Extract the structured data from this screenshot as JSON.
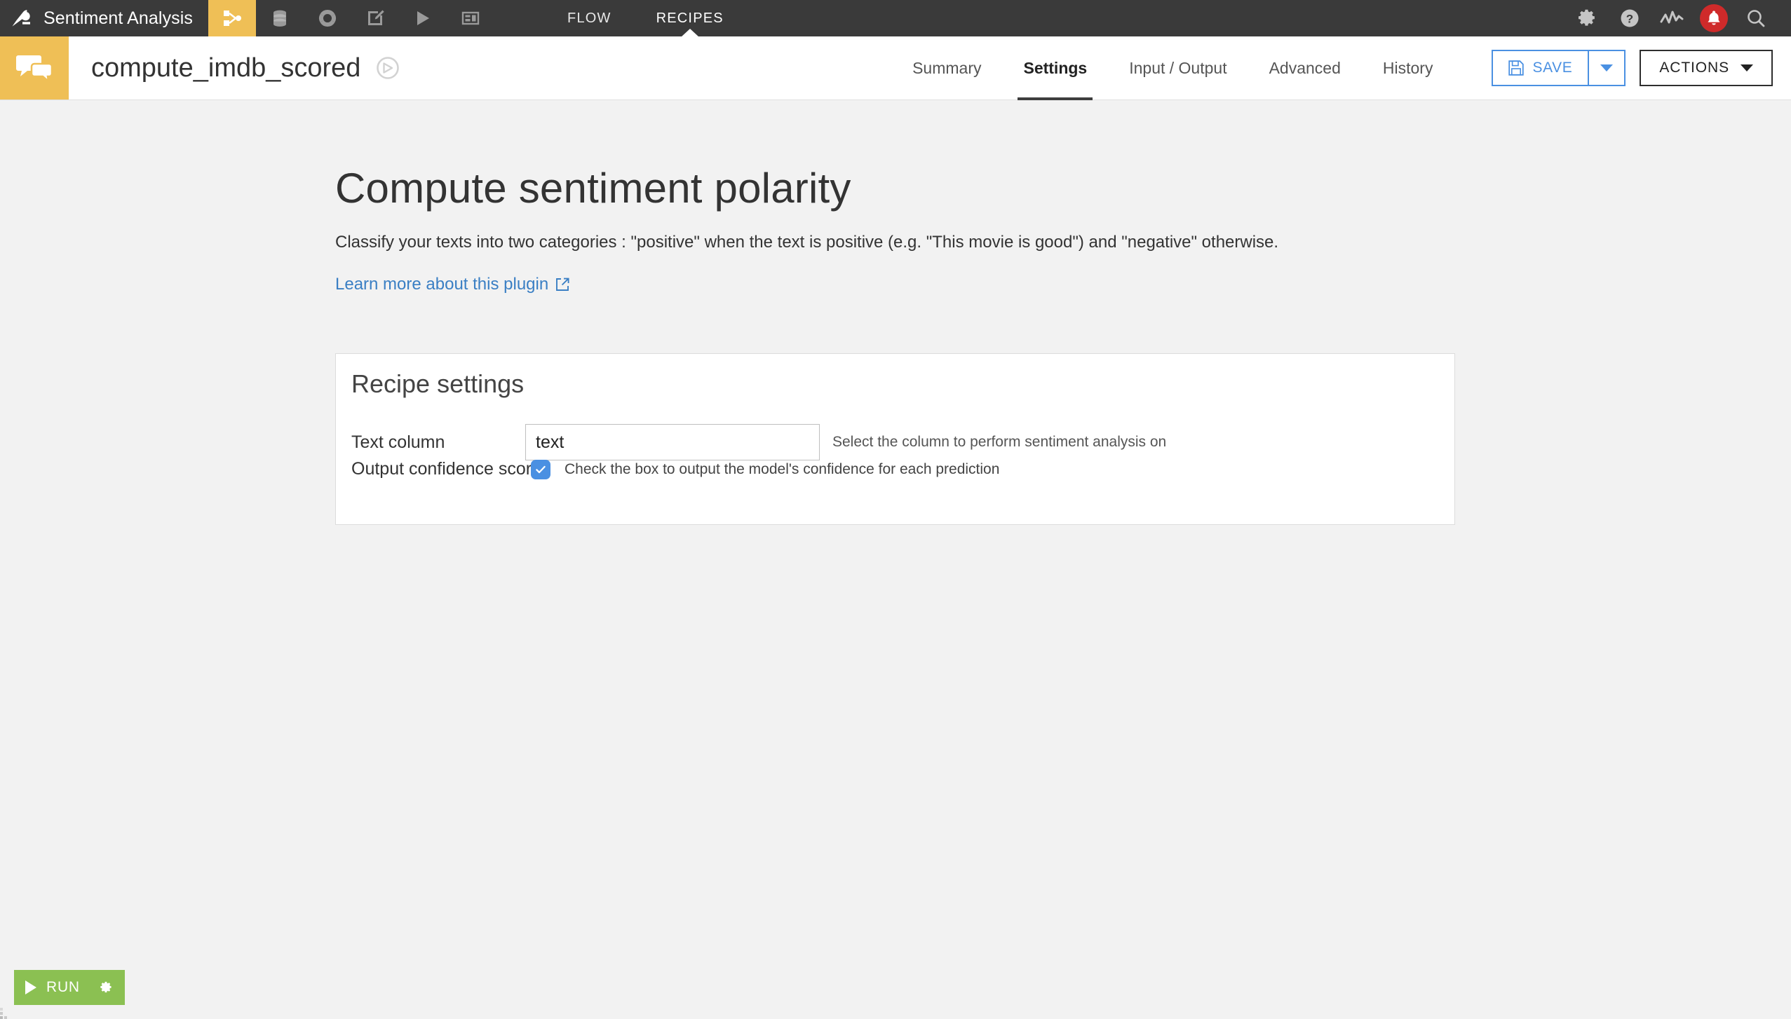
{
  "topbar": {
    "logo_icon": "dataiku-bird-logo",
    "project_name": "Sentiment Analysis",
    "nav_icons": [
      {
        "name": "flow-recipe-icon",
        "label": "Flow"
      },
      {
        "name": "datasets-icon",
        "label": "Datasets"
      },
      {
        "name": "lab-models-icon",
        "label": "Lab"
      },
      {
        "name": "notebooks-icon",
        "label": "Notebooks"
      },
      {
        "name": "scenarios-icon",
        "label": "Scenarios"
      },
      {
        "name": "dashboards-icon",
        "label": "Dashboards"
      }
    ],
    "sections": [
      {
        "label": "FLOW",
        "active": false
      },
      {
        "label": "RECIPES",
        "active": true
      }
    ],
    "right_icons": [
      {
        "name": "gear-icon",
        "label": "Settings"
      },
      {
        "name": "help-icon",
        "label": "Help"
      },
      {
        "name": "activity-monitor-icon",
        "label": "Monitoring"
      },
      {
        "name": "notification-bell-icon",
        "label": "Notifications"
      },
      {
        "name": "search-icon",
        "label": "Search"
      }
    ]
  },
  "subheader": {
    "recipe_icon": "sentiment-chat-bubbles-icon",
    "recipe_name": "compute_imdb_scored",
    "navigator_icon": "compass-navigator-icon",
    "tabs": [
      {
        "label": "Summary",
        "active": false
      },
      {
        "label": "Settings",
        "active": true
      },
      {
        "label": "Input / Output",
        "active": false
      },
      {
        "label": "Advanced",
        "active": false
      },
      {
        "label": "History",
        "active": false
      }
    ],
    "save_label": "SAVE",
    "save_icon": "floppy-disk-icon",
    "save_dropdown_icon": "chevron-down-icon",
    "actions_label": "ACTIONS",
    "actions_dropdown_icon": "chevron-down-icon"
  },
  "main": {
    "heading": "Compute sentiment polarity",
    "description": "Classify your texts into two categories : \"positive\" when the text is positive (e.g. \"This movie is good\") and \"negative\" otherwise.",
    "learn_more_label": "Learn more about this plugin",
    "learn_more_icon": "external-link-icon",
    "panel": {
      "title": "Recipe settings",
      "text_column": {
        "label": "Text column",
        "value": "text",
        "placeholder": "",
        "help": "Select the column to perform sentiment analysis on"
      },
      "output_confidence": {
        "label": "Output confidence scores",
        "checked": true,
        "help": "Check the box to output the model's confidence for each prediction"
      }
    }
  },
  "footer": {
    "run_label": "RUN",
    "run_play_icon": "play-triangle-icon",
    "run_settings_icon": "gear-icon"
  },
  "colors": {
    "topbar_bg": "#3a3a3a",
    "accent_yellow": "#efbf56",
    "link_blue": "#3a7fc4",
    "save_blue": "#4a90e2",
    "run_green": "#8bc052",
    "bell_red": "#cf2a2a",
    "page_bg": "#f2f2f2"
  }
}
